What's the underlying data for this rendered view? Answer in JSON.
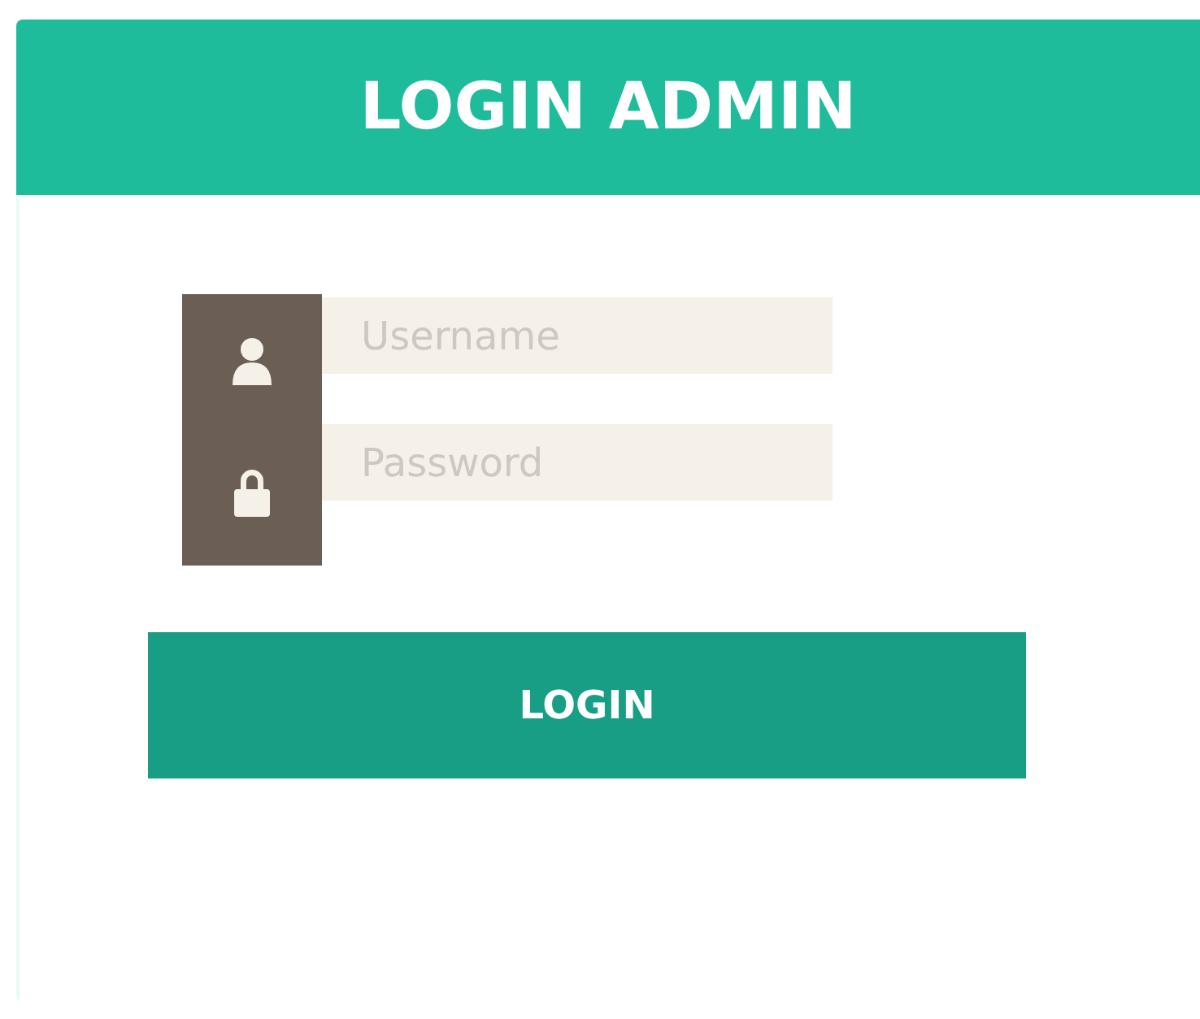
{
  "header": {
    "title": "LOGIN ADMIN"
  },
  "fields": [
    {
      "kind": "user",
      "placeholder": "Username"
    },
    {
      "kind": "lock",
      "placeholder": "Password"
    }
  ],
  "button": {
    "label": "LOGIN"
  }
}
